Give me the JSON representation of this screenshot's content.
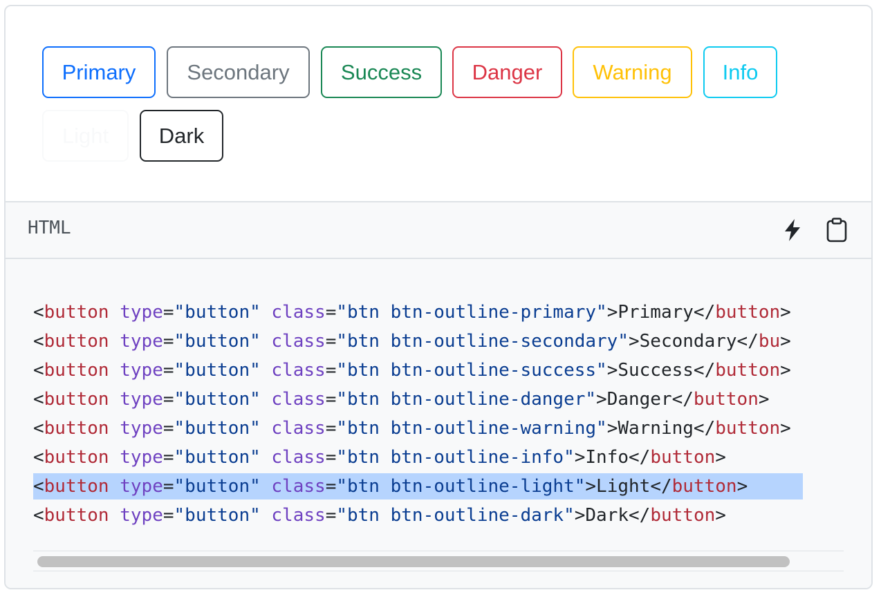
{
  "buttons": [
    {
      "label": "Primary",
      "color": "#0d6efd"
    },
    {
      "label": "Secondary",
      "color": "#6c757d"
    },
    {
      "label": "Success",
      "color": "#198754"
    },
    {
      "label": "Danger",
      "color": "#dc3545"
    },
    {
      "label": "Warning",
      "color": "#ffc107"
    },
    {
      "label": "Info",
      "color": "#0dcaf0"
    },
    {
      "label": "Light",
      "color": "#f8f9fa"
    },
    {
      "label": "Dark",
      "color": "#212529"
    }
  ],
  "toolbar": {
    "language": "HTML",
    "run_icon": "lightning-icon",
    "copy_icon": "clipboard-icon"
  },
  "code": {
    "lines": [
      {
        "tag": "button",
        "type": "button",
        "class": "btn btn-outline-primary",
        "text": "Primary",
        "closing_visible": "button"
      },
      {
        "tag": "button",
        "type": "button",
        "class": "btn btn-outline-secondary",
        "text": "Secondary",
        "closing_visible": "bu"
      },
      {
        "tag": "button",
        "type": "button",
        "class": "btn btn-outline-success",
        "text": "Success",
        "closing_visible": "button"
      },
      {
        "tag": "button",
        "type": "button",
        "class": "btn btn-outline-danger",
        "text": "Danger",
        "closing_visible": "button"
      },
      {
        "tag": "button",
        "type": "button",
        "class": "btn btn-outline-warning",
        "text": "Warning",
        "closing_visible": "button"
      },
      {
        "tag": "button",
        "type": "button",
        "class": "btn btn-outline-info",
        "text": "Info",
        "closing_visible": "button"
      },
      {
        "tag": "button",
        "type": "button",
        "class": "btn btn-outline-light",
        "text": "Light",
        "closing_visible": "button",
        "selected": true
      },
      {
        "tag": "button",
        "type": "button",
        "class": "btn btn-outline-dark",
        "text": "Dark",
        "closing_visible": "button"
      }
    ]
  }
}
